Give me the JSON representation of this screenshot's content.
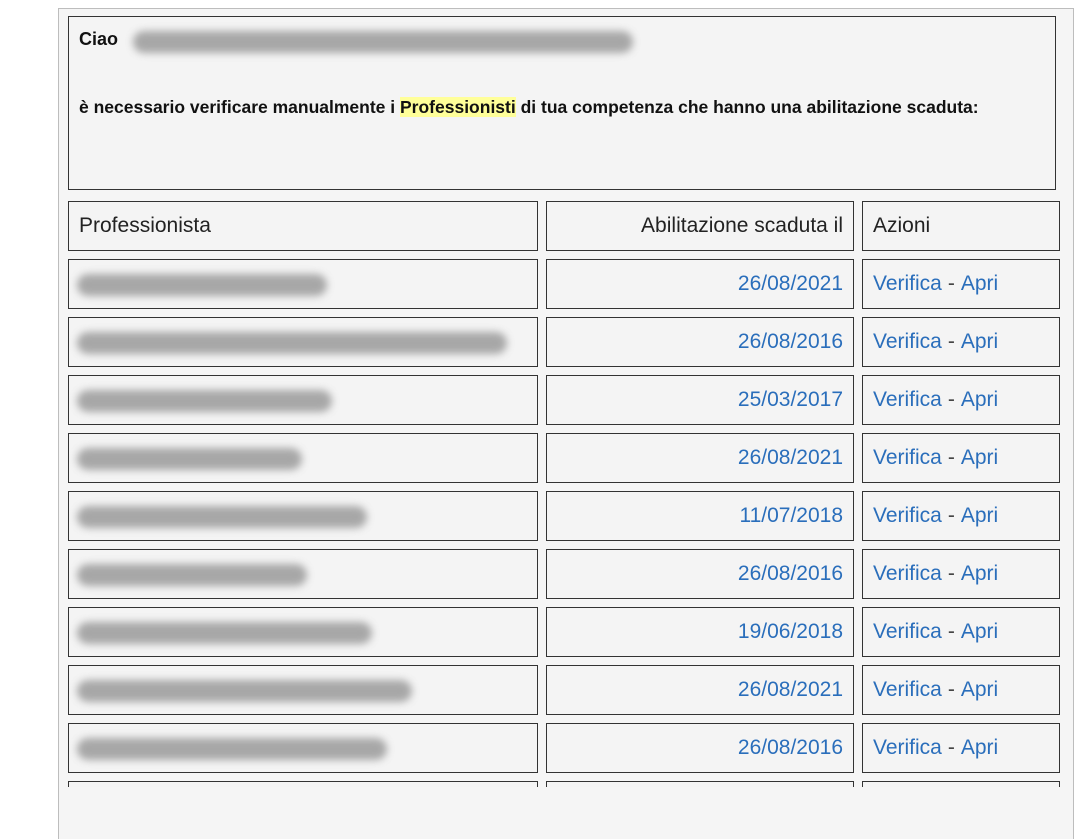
{
  "header": {
    "greeting": "Ciao",
    "message_before": "è necessario verificare manualmente i ",
    "message_highlight": "Professionisti",
    "message_after": " di tua competenza che hanno una abilitazione scaduta:"
  },
  "table": {
    "columns": [
      "Professionista",
      "Abilitazione scaduta il",
      "Azioni"
    ],
    "actions": {
      "verify_label": "Verifica",
      "separator": "-",
      "open_label": "Apri"
    },
    "rows": [
      {
        "date": "26/08/2021"
      },
      {
        "date": "26/08/2016"
      },
      {
        "date": "25/03/2017"
      },
      {
        "date": "26/08/2021"
      },
      {
        "date": "11/07/2018"
      },
      {
        "date": "26/08/2016"
      },
      {
        "date": "19/06/2018"
      },
      {
        "date": "26/08/2021"
      },
      {
        "date": "26/08/2016"
      }
    ]
  }
}
